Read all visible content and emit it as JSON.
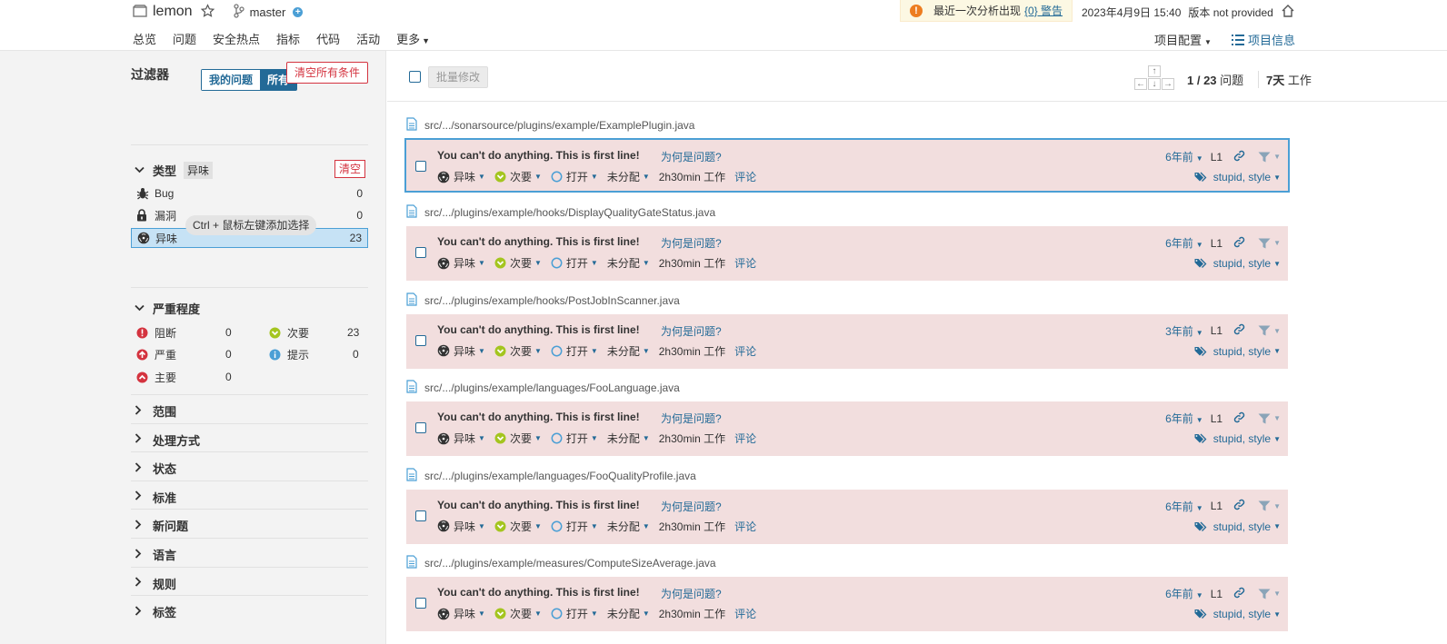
{
  "header": {
    "project_name": "lemon",
    "branch": "master",
    "warning_text": "最近一次分析出现",
    "warning_link": "{0} 警告",
    "date": "2023年4月9日 15:40",
    "version": "版本 not provided"
  },
  "nav": {
    "tabs": [
      "总览",
      "问题",
      "安全热点",
      "指标",
      "代码",
      "活动",
      "更多"
    ],
    "active_index": 1,
    "project_config": "项目配置",
    "project_info": "项目信息"
  },
  "sidebar": {
    "toggle_mine": "我的问题",
    "toggle_all": "所有",
    "filter_title": "过滤器",
    "clear_all": "清空所有条件",
    "type_facet": {
      "title": "类型",
      "badge": "异味",
      "clear": "清空",
      "items": [
        {
          "icon": "bug-icon",
          "label": "Bug",
          "count": "0"
        },
        {
          "icon": "lock-icon",
          "label": "漏洞",
          "count": "0"
        },
        {
          "icon": "code-smell-icon",
          "label": "异味",
          "count": "23",
          "selected": true
        }
      ]
    },
    "ctrl_hint": "Ctrl + 鼠标左键添加选择",
    "severity_facet": {
      "title": "严重程度",
      "items": [
        {
          "icon": "blocker-icon",
          "label": "阻断",
          "count": "0"
        },
        {
          "icon": "minor-icon",
          "label": "次要",
          "count": "23"
        },
        {
          "icon": "critical-icon",
          "label": "严重",
          "count": "0"
        },
        {
          "icon": "info-icon",
          "label": "提示",
          "count": "0"
        },
        {
          "icon": "major-icon",
          "label": "主要",
          "count": "0"
        }
      ]
    },
    "collapsed_facets": [
      "范围",
      "处理方式",
      "状态",
      "标准",
      "新问题",
      "语言",
      "规则",
      "标签"
    ]
  },
  "toolbar": {
    "bulk_change": "批量修改",
    "counter_current": "1",
    "counter_total": "23",
    "counter_label": "问题",
    "effort_value": "7天",
    "effort_label": "工作"
  },
  "issue_labels": {
    "why": "为何是问题?",
    "type": "异味",
    "severity": "次要",
    "status": "打开",
    "assignee": "未分配",
    "effort": "2h30min 工作",
    "comment": "评论",
    "line": "L1",
    "tags": "stupid, style"
  },
  "issues": [
    {
      "file": "src/.../sonarsource/plugins/example/ExamplePlugin.java",
      "message": "You can't do anything. This is first line!",
      "age": "6年前"
    },
    {
      "file": "src/.../plugins/example/hooks/DisplayQualityGateStatus.java",
      "message": "You can't do anything. This is first line!",
      "age": "6年前"
    },
    {
      "file": "src/.../plugins/example/hooks/PostJobInScanner.java",
      "message": "You can't do anything. This is first line!",
      "age": "3年前"
    },
    {
      "file": "src/.../plugins/example/languages/FooLanguage.java",
      "message": "You can't do anything. This is first line!",
      "age": "6年前"
    },
    {
      "file": "src/.../plugins/example/languages/FooQualityProfile.java",
      "message": "You can't do anything. This is first line!",
      "age": "6年前"
    },
    {
      "file": "src/.../plugins/example/measures/ComputeSizeAverage.java",
      "message": "You can't do anything. This is first line!",
      "age": "6年前"
    }
  ]
}
